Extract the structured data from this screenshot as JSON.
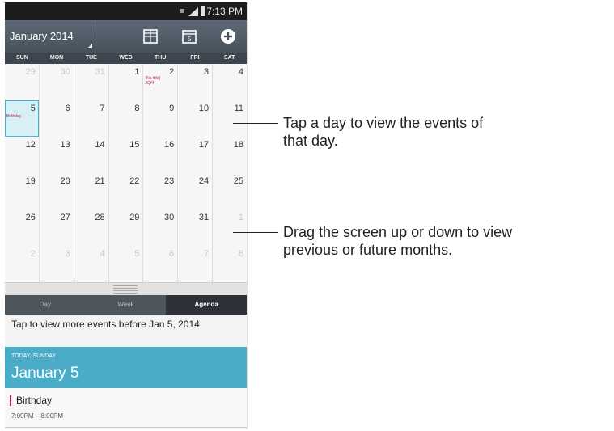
{
  "status_bar": {
    "time": "7:13 PM"
  },
  "header": {
    "month_label": "January 2014"
  },
  "weekdays": [
    "SUN",
    "MON",
    "TUE",
    "WED",
    "THU",
    "FRI",
    "SAT"
  ],
  "weeks": [
    [
      "29",
      "30",
      "31",
      "1",
      "2",
      "3",
      "4"
    ],
    [
      "5",
      "6",
      "7",
      "8",
      "9",
      "10",
      "11"
    ],
    [
      "12",
      "13",
      "14",
      "15",
      "16",
      "17",
      "18"
    ],
    [
      "19",
      "20",
      "21",
      "22",
      "23",
      "24",
      "25"
    ],
    [
      "26",
      "27",
      "28",
      "29",
      "30",
      "31",
      "1"
    ],
    [
      "2",
      "3",
      "4",
      "5",
      "6",
      "7",
      "8"
    ]
  ],
  "events": {
    "jan2_line1": "(No title)",
    "jan2_line2": "JQFI",
    "jan5": "Birthday"
  },
  "view_tabs": [
    "Day",
    "Week",
    "Agenda"
  ],
  "agenda": {
    "more_link": "Tap to view more events before Jan 5, 2014",
    "day_small": "TODAY, SUNDAY",
    "day_big": "January 5",
    "event_title": "Birthday",
    "event_time": "7:00PM – 8:00PM"
  },
  "callouts": {
    "first_line1": "Tap a day to view the events of",
    "first_line2": "that day.",
    "second_line1": "Drag the screen up or down to view",
    "second_line2": "previous or future months."
  },
  "colors": {
    "accent": "#4aacc6",
    "header_bg": "#46515b",
    "event": "#b0204a"
  }
}
